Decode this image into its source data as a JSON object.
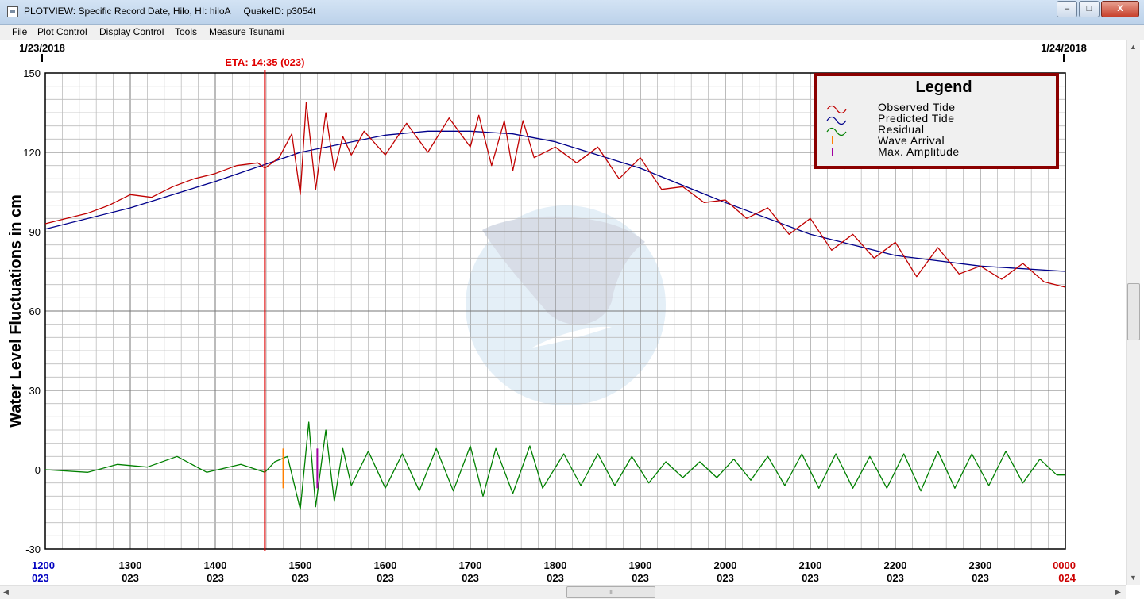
{
  "window": {
    "title": "PLOTVIEW: Specific Record Date, Hilo, HI: hiloA     QuakeID: p3054t",
    "minimize_label": "–",
    "maximize_label": "□",
    "close_label": "X"
  },
  "menu": {
    "items": [
      "File",
      "Plot Control",
      "Display Control",
      "Tools",
      "Measure Tsunami"
    ]
  },
  "scrollbar": {
    "grip_label": "III"
  },
  "colors": {
    "observed": "#c00000",
    "predicted": "#00008b",
    "residual": "#008000",
    "wave_arrival": "#ff7f00",
    "max_amplitude": "#a000a0",
    "eta_line": "#e00000",
    "legend_border": "#8b0000",
    "start_tick": "#0000c0",
    "end_tick": "#cc0000"
  },
  "chart_data": {
    "type": "line",
    "ylabel": "Water Level Fluctuations in cm",
    "ylim": [
      -30,
      150
    ],
    "y_ticks": [
      "150",
      "120",
      "90",
      "60",
      "30",
      "0",
      "-30"
    ],
    "y_tick_values": [
      150,
      120,
      90,
      60,
      30,
      0,
      -30
    ],
    "xlim_hours": [
      12,
      24
    ],
    "x_ticks": [
      {
        "time": "1200",
        "day": "023"
      },
      {
        "time": "1300",
        "day": "023"
      },
      {
        "time": "1400",
        "day": "023"
      },
      {
        "time": "1500",
        "day": "023"
      },
      {
        "time": "1600",
        "day": "023"
      },
      {
        "time": "1700",
        "day": "023"
      },
      {
        "time": "1800",
        "day": "023"
      },
      {
        "time": "1900",
        "day": "023"
      },
      {
        "time": "2000",
        "day": "023"
      },
      {
        "time": "2100",
        "day": "023"
      },
      {
        "time": "2200",
        "day": "023"
      },
      {
        "time": "2300",
        "day": "023"
      },
      {
        "time": "0000",
        "day": "024"
      }
    ],
    "date_start": "1/23/2018",
    "date_end": "1/24/2018",
    "eta": {
      "label": "ETA: 14:35 (023)",
      "hour": 14.583
    },
    "wave_arrival": {
      "hour": 14.8,
      "range": [
        -7,
        8
      ]
    },
    "max_amplitude": {
      "hour": 15.2,
      "range": [
        -7,
        8
      ]
    },
    "legend": {
      "title": "Legend",
      "entries": [
        {
          "label": "Observed Tide",
          "marker": "wave",
          "color": "#c00000"
        },
        {
          "label": "Predicted Tide",
          "marker": "wave",
          "color": "#00008b"
        },
        {
          "label": "Residual",
          "marker": "wave",
          "color": "#008000"
        },
        {
          "label": "Wave Arrival",
          "marker": "bar",
          "color": "#ff7f00"
        },
        {
          "label": "Max. Amplitude",
          "marker": "bar",
          "color": "#a000a0"
        }
      ]
    },
    "series": [
      {
        "name": "Predicted Tide",
        "x": [
          12,
          13,
          14,
          15,
          16,
          16.5,
          17,
          17.5,
          18,
          19,
          20,
          21,
          22,
          23,
          24
        ],
        "values": [
          91,
          99,
          109,
          120,
          126.5,
          128,
          128,
          127,
          124,
          114,
          101,
          89,
          81,
          77,
          75
        ]
      },
      {
        "name": "Observed Tide",
        "x": [
          12,
          12.25,
          12.5,
          12.75,
          13,
          13.25,
          13.5,
          13.75,
          14,
          14.25,
          14.5,
          14.583,
          14.75,
          14.9,
          15.0,
          15.07,
          15.18,
          15.3,
          15.4,
          15.5,
          15.6,
          15.75,
          16,
          16.25,
          16.5,
          16.75,
          17,
          17.1,
          17.25,
          17.4,
          17.5,
          17.62,
          17.75,
          18,
          18.25,
          18.5,
          18.75,
          19,
          19.25,
          19.5,
          19.75,
          20,
          20.25,
          20.5,
          20.75,
          21,
          21.25,
          21.5,
          21.75,
          22,
          22.25,
          22.5,
          22.75,
          23,
          23.25,
          23.5,
          23.75,
          24
        ],
        "values": [
          93,
          95,
          97,
          100,
          104,
          103,
          107,
          110,
          112,
          115,
          116,
          114,
          118,
          127,
          104,
          139,
          106,
          135,
          113,
          126,
          119,
          128,
          119,
          131,
          120,
          133,
          122,
          134,
          115,
          132,
          113,
          132,
          118,
          122,
          116,
          122,
          110,
          118,
          106,
          107,
          101,
          102,
          95,
          99,
          89,
          95,
          83,
          89,
          80,
          86,
          73,
          84,
          74,
          77,
          72,
          78,
          71,
          69
        ]
      },
      {
        "name": "Residual",
        "x": [
          12,
          12.5,
          12.85,
          13.2,
          13.55,
          13.9,
          14.3,
          14.583,
          14.7,
          14.85,
          15.0,
          15.1,
          15.18,
          15.3,
          15.4,
          15.5,
          15.6,
          15.8,
          16.0,
          16.2,
          16.4,
          16.6,
          16.8,
          17.0,
          17.15,
          17.3,
          17.5,
          17.7,
          17.85,
          18.1,
          18.3,
          18.5,
          18.7,
          18.9,
          19.1,
          19.3,
          19.5,
          19.7,
          19.9,
          20.1,
          20.3,
          20.5,
          20.7,
          20.9,
          21.1,
          21.3,
          21.5,
          21.7,
          21.9,
          22.1,
          22.3,
          22.5,
          22.7,
          22.9,
          23.1,
          23.3,
          23.5,
          23.7,
          23.9,
          24
        ],
        "values": [
          0,
          -1,
          2,
          1,
          5,
          -1,
          2,
          -1,
          3,
          5,
          -15,
          18,
          -14,
          15,
          -12,
          8,
          -6,
          7,
          -7,
          6,
          -8,
          8,
          -8,
          9,
          -10,
          8,
          -9,
          9,
          -7,
          6,
          -6,
          6,
          -6,
          5,
          -5,
          3,
          -3,
          3,
          -3,
          4,
          -4,
          5,
          -6,
          6,
          -7,
          6,
          -7,
          5,
          -7,
          6,
          -8,
          7,
          -7,
          6,
          -6,
          7,
          -5,
          4,
          -2,
          -2
        ]
      }
    ]
  }
}
